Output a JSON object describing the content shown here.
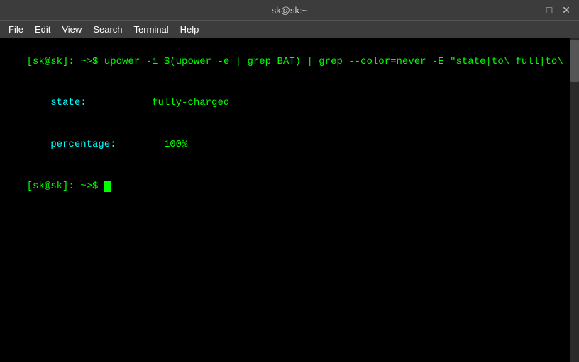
{
  "titlebar": {
    "title": "sk@sk:~",
    "minimize_label": "–",
    "maximize_label": "□",
    "close_label": "✕"
  },
  "menubar": {
    "items": [
      "File",
      "Edit",
      "View",
      "Search",
      "Terminal",
      "Help"
    ]
  },
  "terminal": {
    "lines": [
      {
        "type": "command",
        "prompt": "[sk@sk]: ~>$ ",
        "command": "upower -i $(upower -e | grep BAT) | grep --color=never -E \"state|to\\ full|to\\ empty|percentage\""
      },
      {
        "type": "output-pair",
        "label": "    state:",
        "value": "           fully-charged"
      },
      {
        "type": "output-pair",
        "label": "    percentage:",
        "value": "        100%"
      },
      {
        "type": "prompt-only",
        "prompt": "[sk@sk]: ~>$ "
      }
    ]
  }
}
